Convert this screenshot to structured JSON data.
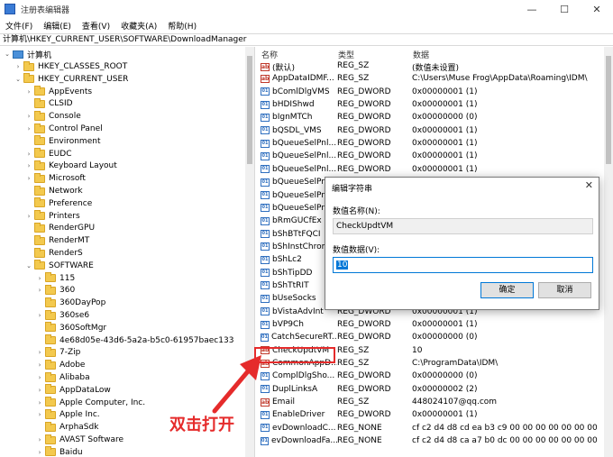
{
  "window": {
    "title": "注册表编辑器",
    "controls": [
      "—",
      "☐",
      "✕"
    ]
  },
  "menu": [
    "文件(F)",
    "编辑(E)",
    "查看(V)",
    "收藏夹(A)",
    "帮助(H)"
  ],
  "address": "计算机\\HKEY_CURRENT_USER\\SOFTWARE\\DownloadManager",
  "tree": {
    "root": "计算机",
    "items": [
      {
        "label": "HKEY_CLASSES_ROOT",
        "level": 1,
        "toggle": "›"
      },
      {
        "label": "HKEY_CURRENT_USER",
        "level": 1,
        "toggle": "⌄"
      },
      {
        "label": "AppEvents",
        "level": 2,
        "toggle": "›"
      },
      {
        "label": "CLSID",
        "level": 2,
        "toggle": ""
      },
      {
        "label": "Console",
        "level": 2,
        "toggle": "›"
      },
      {
        "label": "Control Panel",
        "level": 2,
        "toggle": "›"
      },
      {
        "label": "Environment",
        "level": 2,
        "toggle": ""
      },
      {
        "label": "EUDC",
        "level": 2,
        "toggle": "›"
      },
      {
        "label": "Keyboard Layout",
        "level": 2,
        "toggle": "›"
      },
      {
        "label": "Microsoft",
        "level": 2,
        "toggle": "›"
      },
      {
        "label": "Network",
        "level": 2,
        "toggle": ""
      },
      {
        "label": "Preference",
        "level": 2,
        "toggle": ""
      },
      {
        "label": "Printers",
        "level": 2,
        "toggle": "›"
      },
      {
        "label": "RenderGPU",
        "level": 2,
        "toggle": ""
      },
      {
        "label": "RenderMT",
        "level": 2,
        "toggle": ""
      },
      {
        "label": "RenderS",
        "level": 2,
        "toggle": ""
      },
      {
        "label": "SOFTWARE",
        "level": 2,
        "toggle": "⌄"
      },
      {
        "label": "115",
        "level": 3,
        "toggle": "›"
      },
      {
        "label": "360",
        "level": 3,
        "toggle": "›"
      },
      {
        "label": "360DayPop",
        "level": 3,
        "toggle": ""
      },
      {
        "label": "360se6",
        "level": 3,
        "toggle": "›"
      },
      {
        "label": "360SoftMgr",
        "level": 3,
        "toggle": ""
      },
      {
        "label": "4e68d05e-43d6-5a2a-b5c0-61957baec133",
        "level": 3,
        "toggle": ""
      },
      {
        "label": "7-Zip",
        "level": 3,
        "toggle": "›"
      },
      {
        "label": "Adobe",
        "level": 3,
        "toggle": "›"
      },
      {
        "label": "Alibaba",
        "level": 3,
        "toggle": "›"
      },
      {
        "label": "AppDataLow",
        "level": 3,
        "toggle": "›"
      },
      {
        "label": "Apple Computer, Inc.",
        "level": 3,
        "toggle": "›"
      },
      {
        "label": "Apple Inc.",
        "level": 3,
        "toggle": "›"
      },
      {
        "label": "ArphaSdk",
        "level": 3,
        "toggle": ""
      },
      {
        "label": "AVAST Software",
        "level": 3,
        "toggle": "›"
      },
      {
        "label": "Baidu",
        "level": 3,
        "toggle": "›"
      }
    ]
  },
  "list": {
    "headers": {
      "name": "名称",
      "type": "类型",
      "data": "数据"
    },
    "rows": [
      {
        "name": "(默认)",
        "type": "REG_SZ",
        "data": "(数值未设置)",
        "icon": "ab"
      },
      {
        "name": "AppDataIDMF...",
        "type": "REG_SZ",
        "data": "C:\\Users\\Muse Frog\\AppData\\Roaming\\IDM\\",
        "icon": "ab"
      },
      {
        "name": "bComlDlgVMS",
        "type": "REG_DWORD",
        "data": "0x00000001 (1)",
        "icon": "bin"
      },
      {
        "name": "bHDIShwd",
        "type": "REG_DWORD",
        "data": "0x00000001 (1)",
        "icon": "bin"
      },
      {
        "name": "bIgnMTCh",
        "type": "REG_DWORD",
        "data": "0x00000000 (0)",
        "icon": "bin"
      },
      {
        "name": "bQSDL_VMS",
        "type": "REG_DWORD",
        "data": "0x00000001 (1)",
        "icon": "bin"
      },
      {
        "name": "bQueueSelPnl...",
        "type": "REG_DWORD",
        "data": "0x00000001 (1)",
        "icon": "bin"
      },
      {
        "name": "bQueueSelPnl...",
        "type": "REG_DWORD",
        "data": "0x00000001 (1)",
        "icon": "bin"
      },
      {
        "name": "bQueueSelPnl...",
        "type": "REG_DWORD",
        "data": "0x00000001 (1)",
        "icon": "bin"
      },
      {
        "name": "bQueueSelPnl...",
        "type": "",
        "data": "",
        "icon": "bin"
      },
      {
        "name": "bQueueSelPnl...",
        "type": "",
        "data": "",
        "icon": "bin"
      },
      {
        "name": "bQueueSelPnl...",
        "type": "",
        "data": "",
        "icon": "bin"
      },
      {
        "name": "bRmGUCfEx",
        "type": "",
        "data": "",
        "icon": "bin"
      },
      {
        "name": "bShBTtFQCI",
        "type": "",
        "data": "",
        "icon": "bin"
      },
      {
        "name": "bShInstChrom...",
        "type": "",
        "data": "",
        "icon": "bin"
      },
      {
        "name": "bShLc2",
        "type": "",
        "data": "",
        "icon": "bin"
      },
      {
        "name": "bShTipDD",
        "type": "",
        "data": "",
        "icon": "bin"
      },
      {
        "name": "bShTtRIT",
        "type": "",
        "data": "",
        "icon": "bin"
      },
      {
        "name": "bUseSocks",
        "type": "",
        "data": "",
        "icon": "bin"
      },
      {
        "name": "bVistaAdvInt",
        "type": "REG_DWORD",
        "data": "0x00000001 (1)",
        "icon": "bin"
      },
      {
        "name": "bVP9Ch",
        "type": "REG_DWORD",
        "data": "0x00000001 (1)",
        "icon": "bin"
      },
      {
        "name": "CatchSecureRT...",
        "type": "REG_DWORD",
        "data": "0x00000000 (0)",
        "icon": "bin"
      },
      {
        "name": "CheckUpdtVM",
        "type": "REG_SZ",
        "data": "10",
        "icon": "ab"
      },
      {
        "name": "CommonAppD...",
        "type": "REG_SZ",
        "data": "C:\\ProgramData\\IDM\\",
        "icon": "ab"
      },
      {
        "name": "ComplDlgSho...",
        "type": "REG_DWORD",
        "data": "0x00000000 (0)",
        "icon": "bin"
      },
      {
        "name": "DuplLinksA",
        "type": "REG_DWORD",
        "data": "0x00000002 (2)",
        "icon": "bin"
      },
      {
        "name": "Email",
        "type": "REG_SZ",
        "data": "448024107@qq.com",
        "icon": "ab"
      },
      {
        "name": "EnableDriver",
        "type": "REG_DWORD",
        "data": "0x00000001 (1)",
        "icon": "bin"
      },
      {
        "name": "evDownloadC...",
        "type": "REG_NONE",
        "data": "cf c2 d4 d8 cd ea b3 c9 00 00 00 00 00 00 00",
        "icon": "bin"
      },
      {
        "name": "evDownloadFa...",
        "type": "REG_NONE",
        "data": "cf c2 d4 d8 ca a7 b0 dc 00 00 00 00 00 00 00",
        "icon": "bin"
      }
    ]
  },
  "dialog": {
    "title": "编辑字符串",
    "name_label": "数值名称(N):",
    "name_value": "CheckUpdtVM",
    "data_label": "数值数据(V):",
    "data_value": "10",
    "ok": "确定",
    "cancel": "取消"
  },
  "annotation": {
    "text": "双击打开",
    "color": "#e52b2b"
  }
}
